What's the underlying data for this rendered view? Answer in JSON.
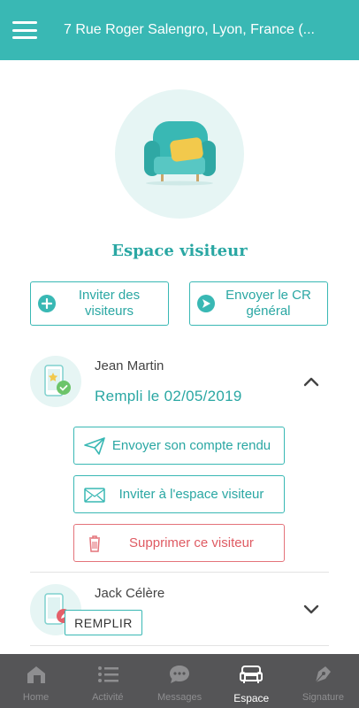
{
  "header": {
    "menu_icon": "hamburger-menu-icon",
    "title": "7 Rue Roger Salengro, Lyon, France (..."
  },
  "hero": {
    "icon": "armchair-icon"
  },
  "section": {
    "title": "Espace visiteur"
  },
  "actions": {
    "invite_label": "Inviter des visiteurs",
    "send_report_label": "Envoyer le CR général"
  },
  "visitors": [
    {
      "name": "Jean Martin",
      "status": "Rempli le 02/05/2019",
      "expanded": true,
      "buttons": {
        "send_report": "Envoyer son compte rendu",
        "invite_space": "Inviter à l'espace visiteur",
        "delete": "Supprimer ce visiteur"
      }
    },
    {
      "name": "Jack Célère",
      "fill_label": "REMPLIR",
      "expanded": false
    }
  ],
  "nav": [
    {
      "label": "Home",
      "icon": "home-icon",
      "active": false
    },
    {
      "label": "Activité",
      "icon": "list-icon",
      "active": false
    },
    {
      "label": "Messages",
      "icon": "chat-bubble-icon",
      "active": false
    },
    {
      "label": "Espace",
      "icon": "armchair-icon",
      "active": true
    },
    {
      "label": "Signature",
      "icon": "pen-nib-icon",
      "active": false
    }
  ],
  "colors": {
    "accent": "#39b8b4",
    "accent_text": "#2aa7a3",
    "danger": "#df5b63",
    "nav_bg": "#555557",
    "soft_bg": "#e6f5f4"
  }
}
